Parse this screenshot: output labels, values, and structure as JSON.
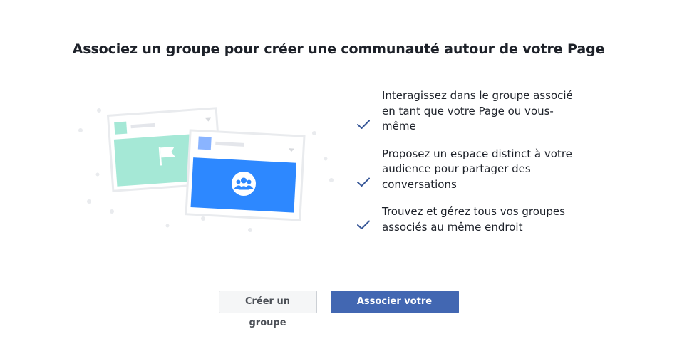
{
  "dialog": {
    "title": "Associez un groupe pour créer une communauté autour de votre Page"
  },
  "benefits": [
    {
      "text": "Interagissez dans le groupe associé en tant que votre Page ou vous-même",
      "icon": "checkmark-icon"
    },
    {
      "text": "Proposez un espace distinct à votre audience pour partager des conversations",
      "icon": "checkmark-icon"
    },
    {
      "text": "Trouvez et gérez tous vos groupes associés au même endroit",
      "icon": "checkmark-icon"
    }
  ],
  "buttons": {
    "create_label": "Créer un groupe",
    "link_label": "Associer votre groupe"
  },
  "illustration": {
    "icons": [
      "flag-icon",
      "group-icon"
    ]
  },
  "colors": {
    "primary": "#4267b2",
    "check": "#385898",
    "teal": "#a5e8d6",
    "blue_cover": "#2d88ff",
    "text": "#1d2129"
  }
}
